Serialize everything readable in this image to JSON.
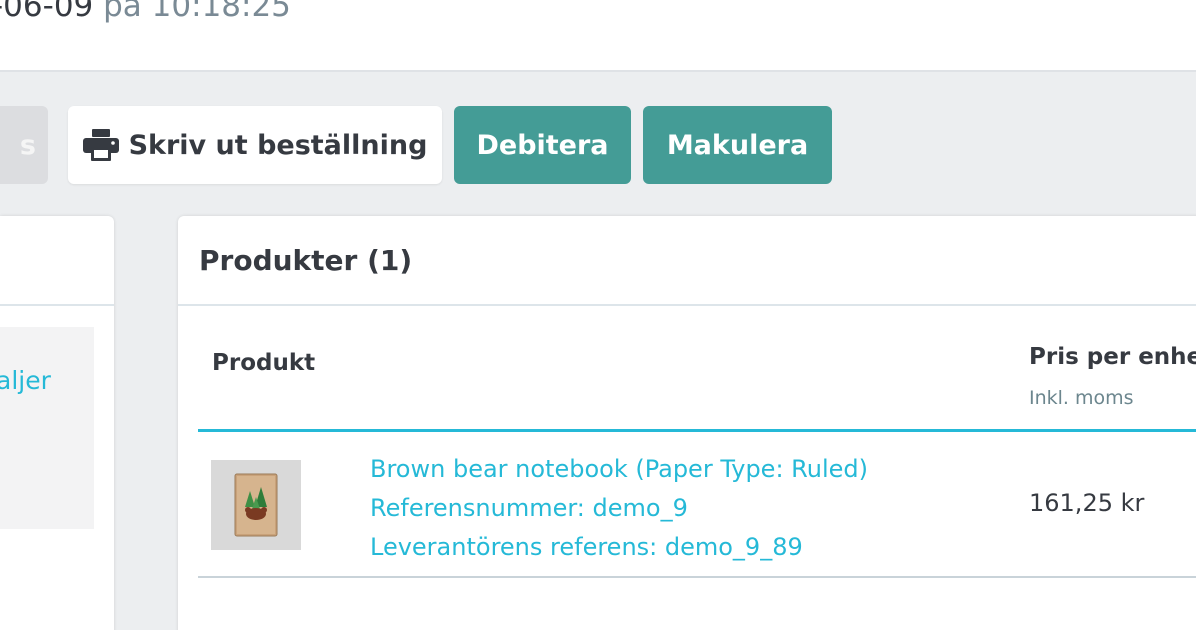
{
  "header": {
    "date_prefix": "-06-09",
    "date_connector": "på",
    "time": "10:18:25"
  },
  "toolbar": {
    "prev_label": "s",
    "print_label": "Skriv ut beställning",
    "print_icon": "printer-icon",
    "debit_label": "Debitera",
    "cancel_label": "Makulera",
    "accent_color": "#449c96"
  },
  "left_panel": {
    "link_label": "aljer"
  },
  "products": {
    "title": "Produkter (1)",
    "columns": {
      "product": "Produkt",
      "unit_price": "Pris per enhe",
      "unit_price_sub": "Inkl. moms"
    },
    "rows": [
      {
        "name": "Brown bear notebook (Paper Type: Ruled)",
        "reference": "Referensnummer: demo_9",
        "supplier_reference": "Leverantörens referens: demo_9_89",
        "unit_price": "161,25 kr"
      }
    ],
    "link_color": "#25b9d7"
  }
}
